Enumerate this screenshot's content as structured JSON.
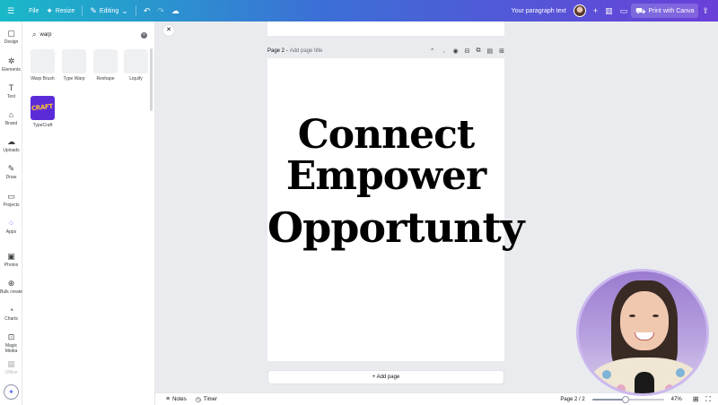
{
  "topbar": {
    "file_label": "File",
    "resize_label": "Resize",
    "editing_label": "Editing",
    "doc_title": "Your paragraph text",
    "print_label": "Print with Canva"
  },
  "rail": {
    "items": [
      {
        "label": "Design",
        "icon": "design-icon"
      },
      {
        "label": "Elements",
        "icon": "elements-icon"
      },
      {
        "label": "Text",
        "icon": "text-icon"
      },
      {
        "label": "Brand",
        "icon": "brand-icon"
      },
      {
        "label": "Uploads",
        "icon": "uploads-icon"
      },
      {
        "label": "Draw",
        "icon": "draw-icon"
      },
      {
        "label": "Projects",
        "icon": "projects-icon"
      },
      {
        "label": "Apps",
        "icon": "apps-icon",
        "active": true
      },
      {
        "label": "Photos",
        "icon": "photos-icon"
      },
      {
        "label": "Bulk create",
        "icon": "bulk-create-icon"
      },
      {
        "label": "Charts",
        "icon": "charts-icon"
      },
      {
        "label": "Magic Media",
        "icon": "magic-media-icon"
      },
      {
        "label": "Offline",
        "icon": "offline-icon"
      }
    ]
  },
  "panel": {
    "search_value": "warp",
    "apps": [
      {
        "label": "Warp Brush"
      },
      {
        "label": "Type Warp"
      },
      {
        "label": "Reshape"
      },
      {
        "label": "Liquify"
      },
      {
        "label": "TypeCraft",
        "thumb_text": "CRAFT"
      }
    ]
  },
  "canvas": {
    "page_label": "Page 2 -",
    "page_title_placeholder": "Add page title",
    "lines": [
      "Connect",
      "Empower",
      "Opportunty"
    ],
    "add_page_label": "+ Add page"
  },
  "bottombar": {
    "notes_label": "Notes",
    "timer_label": "Timer",
    "page_indicator": "Page 2 / 2",
    "zoom_label": "47%",
    "zoom_value": 0.47
  },
  "colors": {
    "accent": "#5d6cf0",
    "topbar_start": "#19b9c8",
    "topbar_end": "#6a3fd8",
    "typecraft_bg": "#5c2bd8"
  }
}
